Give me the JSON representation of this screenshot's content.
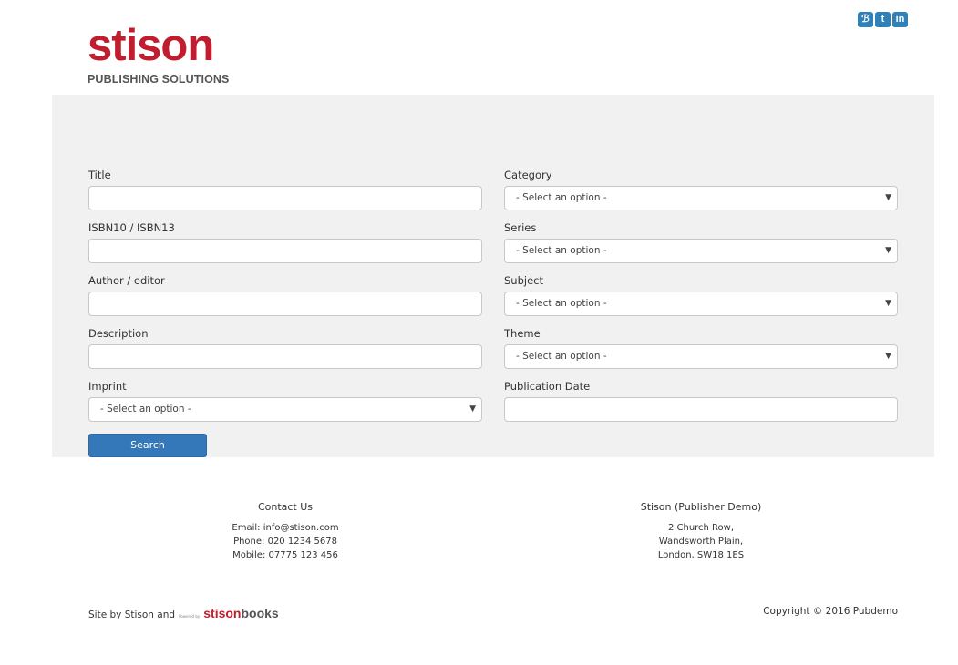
{
  "header": {
    "logo_text": "stison",
    "logo_tagline": "PUBLISHING SOLUTIONS",
    "social": [
      {
        "icon": "rss-icon",
        "glyph": "ℬ"
      },
      {
        "icon": "twitter-icon",
        "glyph": "t"
      },
      {
        "icon": "linkedin-icon",
        "glyph": "in"
      }
    ]
  },
  "form": {
    "title_label": "Title",
    "title_value": "",
    "isbn_label": "ISBN10 / ISBN13",
    "isbn_value": "",
    "author_label": "Author / editor",
    "author_value": "",
    "description_label": "Description",
    "description_value": "",
    "imprint_label": "Imprint",
    "imprint_value": "- Select an option -",
    "category_label": "Category",
    "category_value": "- Select an option -",
    "series_label": "Series",
    "series_value": "- Select an option -",
    "subject_label": "Subject",
    "subject_value": "- Select an option -",
    "theme_label": "Theme",
    "theme_value": "- Select an option -",
    "pubdate_label": "Publication Date",
    "pubdate_value": "",
    "search_label": "Search"
  },
  "footer": {
    "contact_heading": "Contact Us",
    "email": "Email: info@stison.com",
    "phone": "Phone: 020 1234 5678",
    "mobile": "Mobile: 07775 123 456",
    "company_heading": "Stison (Publisher Demo)",
    "address1": "2 Church Row,",
    "address2": "Wandsworth Plain,",
    "address3": "London, SW18 1ES",
    "site_by": "Site by Stison and",
    "powered_by": "Powered by",
    "brand_red": "stison",
    "brand_grey": "books",
    "copyright": "Copyright © 2016 Pubdemo"
  },
  "colors": {
    "brand_red": "#c01d2e",
    "panel_bg": "#f1f1f1",
    "button_blue": "#3478b9",
    "social_blue": "#2f81b8"
  }
}
